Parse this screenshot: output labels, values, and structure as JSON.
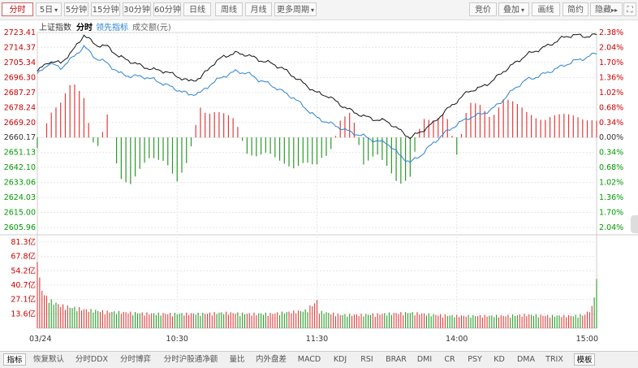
{
  "toolbar": {
    "periods": [
      "分时",
      "5日",
      "5分钟",
      "15分钟",
      "30分钟",
      "60分钟",
      "日线",
      "周线",
      "月线",
      "更多周期"
    ],
    "dropdown_arrow": "▾",
    "right_tools": [
      "竞价",
      "叠加",
      "画线",
      "简约",
      "隐藏"
    ],
    "hide_arrows": "▸▸",
    "expand_icon": "⛶"
  },
  "legend": {
    "index_name": "上证指数",
    "mode": "分时",
    "leading_label": "领先指标",
    "volume_label": "成交额(元)"
  },
  "colors": {
    "price_line": "#111111",
    "leading_line": "#2a82d2",
    "up": "#e03c3c",
    "down": "#2a9a2a",
    "axis_up_text": "#cc0000",
    "axis_down_text": "#009900",
    "grid": "#e6e6e6"
  },
  "bottom_tabs": [
    "指标",
    "恢复默认",
    "分时DDX",
    "分时博弈",
    "分时沪股通净额",
    "量比",
    "内外盘差",
    "MACD",
    "KDJ",
    "RSI",
    "BRAR",
    "DMI",
    "CR",
    "PSY",
    "KD",
    "DMA",
    "TRIX",
    "模板"
  ],
  "chart_data": {
    "type": "line",
    "x_tick_labels": [
      "03/24",
      "10:30",
      "11:30",
      "14:00",
      "15:00"
    ],
    "price_axis": {
      "ticks": [
        2723.41,
        2714.37,
        2705.34,
        2696.3,
        2687.27,
        2678.24,
        2669.2,
        2660.17,
        2651.13,
        2642.1,
        2633.06,
        2624.03,
        2615.0,
        2605.96
      ],
      "pct_ticks": [
        "2.38%",
        "2.04%",
        "1.70%",
        "1.36%",
        "1.02%",
        "0.68%",
        "0.34%",
        "0.00%",
        "0.34%",
        "0.68%",
        "1.02%",
        "1.36%",
        "1.70%",
        "2.04%"
      ],
      "ylim": [
        2605.96,
        2723.41
      ],
      "prev_close": 2660.17
    },
    "volume_axis": {
      "ticks": [
        "81.3亿",
        "67.8亿",
        "54.2亿",
        "40.7亿",
        "27.1亿",
        "13.6亿"
      ],
      "ylim": [
        0,
        81.3
      ]
    },
    "series": [
      {
        "name": "上证指数",
        "time_index": [
          0,
          5,
          10,
          15,
          20,
          25,
          30,
          35,
          40,
          45,
          50,
          55,
          60,
          65,
          70,
          75,
          80,
          85,
          90,
          95,
          100,
          105,
          110,
          115,
          120,
          125,
          130,
          135,
          140,
          145,
          150,
          155,
          160,
          165,
          170,
          175,
          180,
          185,
          190,
          195,
          200,
          205,
          210,
          215,
          220,
          225,
          230,
          235,
          240
        ],
        "values": [
          2700,
          2706,
          2705,
          2712,
          2722,
          2716,
          2715,
          2709,
          2706,
          2703,
          2701,
          2700,
          2697,
          2694,
          2696,
          2704,
          2709,
          2711,
          2710,
          2707,
          2705,
          2702,
          2697,
          2692,
          2687,
          2685,
          2680,
          2676,
          2673,
          2671,
          2670,
          2665,
          2660,
          2664,
          2669,
          2676,
          2682,
          2688,
          2690,
          2694,
          2700,
          2705,
          2710,
          2713,
          2716,
          2720,
          2722,
          2721,
          2722
        ]
      },
      {
        "name": "领先指标",
        "time_index": [
          0,
          5,
          10,
          15,
          20,
          25,
          30,
          35,
          40,
          45,
          50,
          55,
          60,
          65,
          70,
          75,
          80,
          85,
          90,
          95,
          100,
          105,
          110,
          115,
          120,
          125,
          130,
          135,
          140,
          145,
          150,
          155,
          160,
          165,
          170,
          175,
          180,
          185,
          190,
          195,
          200,
          205,
          210,
          215,
          220,
          225,
          230,
          235,
          240
        ],
        "values": [
          2698,
          2705,
          2702,
          2708,
          2715,
          2708,
          2705,
          2699,
          2697,
          2697,
          2695,
          2692,
          2689,
          2686,
          2687,
          2693,
          2697,
          2700,
          2699,
          2695,
          2692,
          2688,
          2684,
          2678,
          2672,
          2669,
          2666,
          2663,
          2661,
          2658,
          2657,
          2650,
          2645,
          2650,
          2657,
          2663,
          2668,
          2672,
          2674,
          2677,
          2683,
          2690,
          2695,
          2697,
          2700,
          2703,
          2706,
          2708,
          2711
        ]
      }
    ],
    "leading_bars": {
      "time_index": [
        0,
        5,
        10,
        15,
        20,
        25,
        30,
        35,
        40,
        45,
        50,
        55,
        60,
        65,
        70,
        75,
        80,
        85,
        90,
        95,
        100,
        105,
        110,
        115,
        120,
        125,
        130,
        135,
        140,
        145,
        150,
        155,
        160,
        165,
        170,
        175,
        180,
        185,
        190,
        195,
        200,
        205,
        210,
        215,
        220,
        225,
        230,
        235,
        240
      ],
      "values": [
        -0.4,
        0.6,
        0.8,
        1.3,
        1.1,
        -0.5,
        0.6,
        -0.9,
        -1.1,
        -0.8,
        -0.7,
        -0.6,
        -1.0,
        -0.5,
        0.9,
        0.8,
        0.6,
        0.4,
        -0.4,
        -0.6,
        -0.5,
        -0.6,
        -0.7,
        -0.6,
        -0.9,
        -0.5,
        0.4,
        0.6,
        -0.7,
        -0.6,
        -0.8,
        -1.1,
        -0.9,
        0.5,
        0.6,
        0.7,
        -0.4,
        0.8,
        0.9,
        0.7,
        1.0,
        0.8,
        0.6,
        0.5,
        0.7,
        0.6,
        0.5,
        0.4,
        0.5
      ],
      "unit": "percent"
    },
    "volume": {
      "time_index": [
        0,
        1,
        2,
        3,
        4,
        5,
        6,
        8,
        10,
        12,
        15,
        18,
        20,
        25,
        30,
        40,
        50,
        60,
        70,
        80,
        90,
        100,
        110,
        115,
        120,
        121,
        130,
        140,
        150,
        160,
        170,
        180,
        190,
        200,
        210,
        220,
        230,
        235,
        238,
        240
      ],
      "values": [
        78,
        46,
        38,
        32,
        30,
        28,
        26,
        24,
        22,
        21,
        20,
        19,
        18,
        17,
        16,
        15,
        14,
        14,
        14,
        15,
        14,
        14,
        16,
        17,
        26,
        16,
        13,
        13,
        14,
        15,
        13,
        12,
        12,
        12,
        13,
        12,
        12,
        13,
        20,
        46
      ]
    },
    "grid": true
  }
}
